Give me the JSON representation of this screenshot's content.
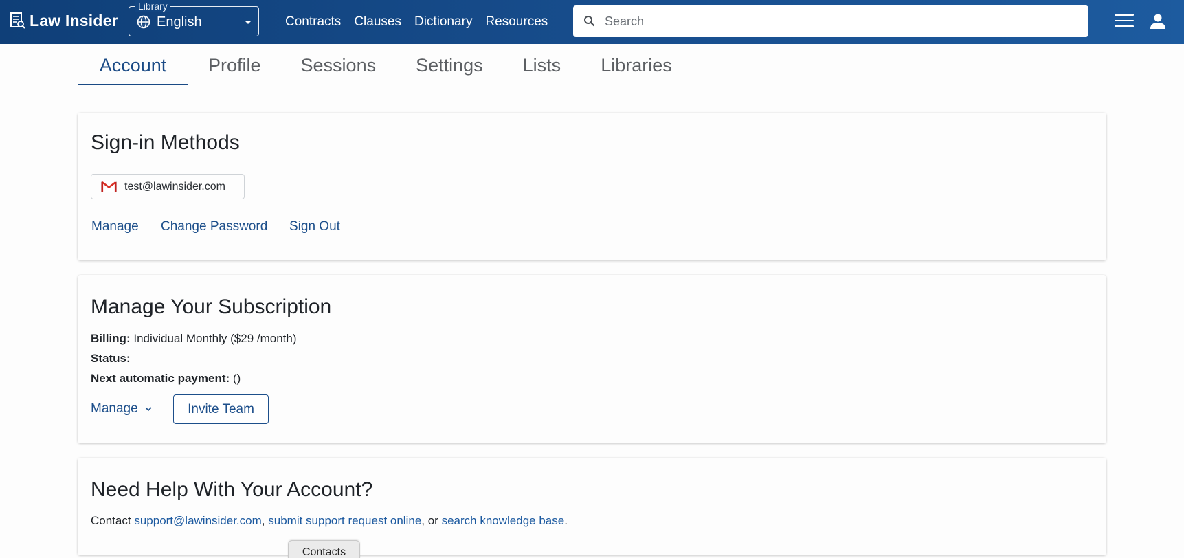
{
  "header": {
    "logo_text": "Law Insider",
    "library": {
      "legend": "Library",
      "value": "English"
    },
    "nav": [
      "Contracts",
      "Clauses",
      "Dictionary",
      "Resources"
    ],
    "search": {
      "placeholder": "Search",
      "value": ""
    },
    "icons": [
      "book-logo-icon",
      "globe-icon",
      "search-icon",
      "hamburger-menu-icon",
      "user-icon"
    ]
  },
  "tabs": {
    "active": "Account",
    "items": [
      "Account",
      "Profile",
      "Sessions",
      "Settings",
      "Lists",
      "Libraries"
    ]
  },
  "signin": {
    "title": "Sign-in Methods",
    "email": "test@lawinsider.com",
    "links": {
      "manage": "Manage",
      "change_password": "Change Password",
      "sign_out": "Sign Out"
    }
  },
  "subscription": {
    "title": "Manage Your Subscription",
    "billing_label": "Billing:",
    "billing_value": "Individual Monthly ($29 /month)",
    "status_label": "Status:",
    "status_value": "",
    "next_payment_label": "Next automatic payment:",
    "next_payment_value": "()",
    "manage_label": "Manage",
    "invite_label": "Invite Team"
  },
  "help": {
    "title": "Need Help With Your Account?",
    "prefix": "Contact",
    "email_link": "support@lawinsider.com",
    "sep1": ",",
    "request_link": "submit support request online",
    "sep2": ", or",
    "kb_link": "search knowledge base",
    "suffix": "."
  },
  "contacts_tab": "Contacts",
  "colors": {
    "header": "#164a88",
    "accent": "#1a4a85",
    "link": "#1d5aa0"
  }
}
